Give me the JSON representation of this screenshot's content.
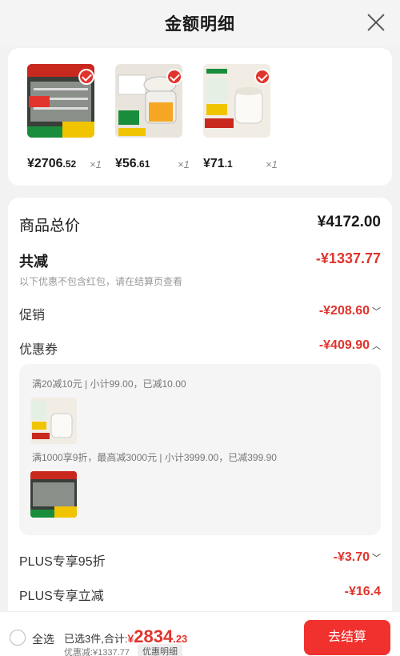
{
  "header": {
    "title": "金额明细"
  },
  "products": [
    {
      "name": "dishwasher",
      "price_int": "¥2706",
      "price_dec": ".52",
      "qty": "×1"
    },
    {
      "name": "food-chopper",
      "price_int": "¥56",
      "price_dec": ".61",
      "qty": "×1"
    },
    {
      "name": "kettle",
      "price_int": "¥71",
      "price_dec": ".1",
      "qty": "×1"
    }
  ],
  "summary": {
    "total_label": "商品总价",
    "total_value": "¥4172.00",
    "discount_label": "共减",
    "discount_value": "-¥1337.77",
    "discount_note": "以下优惠不包含红包，请在结算页查看",
    "promo_label": "促销",
    "promo_value": "-¥208.60",
    "coupon_label": "优惠券",
    "coupon_value": "-¥409.90",
    "plus95_label": "PLUS专享95折",
    "plus95_value": "-¥3.70",
    "plusdirect_label": "PLUS专享立减",
    "plusdirect_value": "-¥16.4"
  },
  "coupon_details": {
    "line1": "满20减10元 | 小计99.00，已减10.00",
    "line2": "满1000享9折，最高减3000元 | 小计3999.00，已减399.90"
  },
  "bottom": {
    "select_all": "全选",
    "selected_text": "已选3件,合计:",
    "currency": "¥",
    "amount_int": "2834",
    "amount_dec": ".23",
    "saved": "优惠减:¥1337.77",
    "detail_badge": "优惠明细",
    "checkout": "去结算"
  },
  "colors": {
    "accent": "#e0342c",
    "button": "#f0312d"
  }
}
